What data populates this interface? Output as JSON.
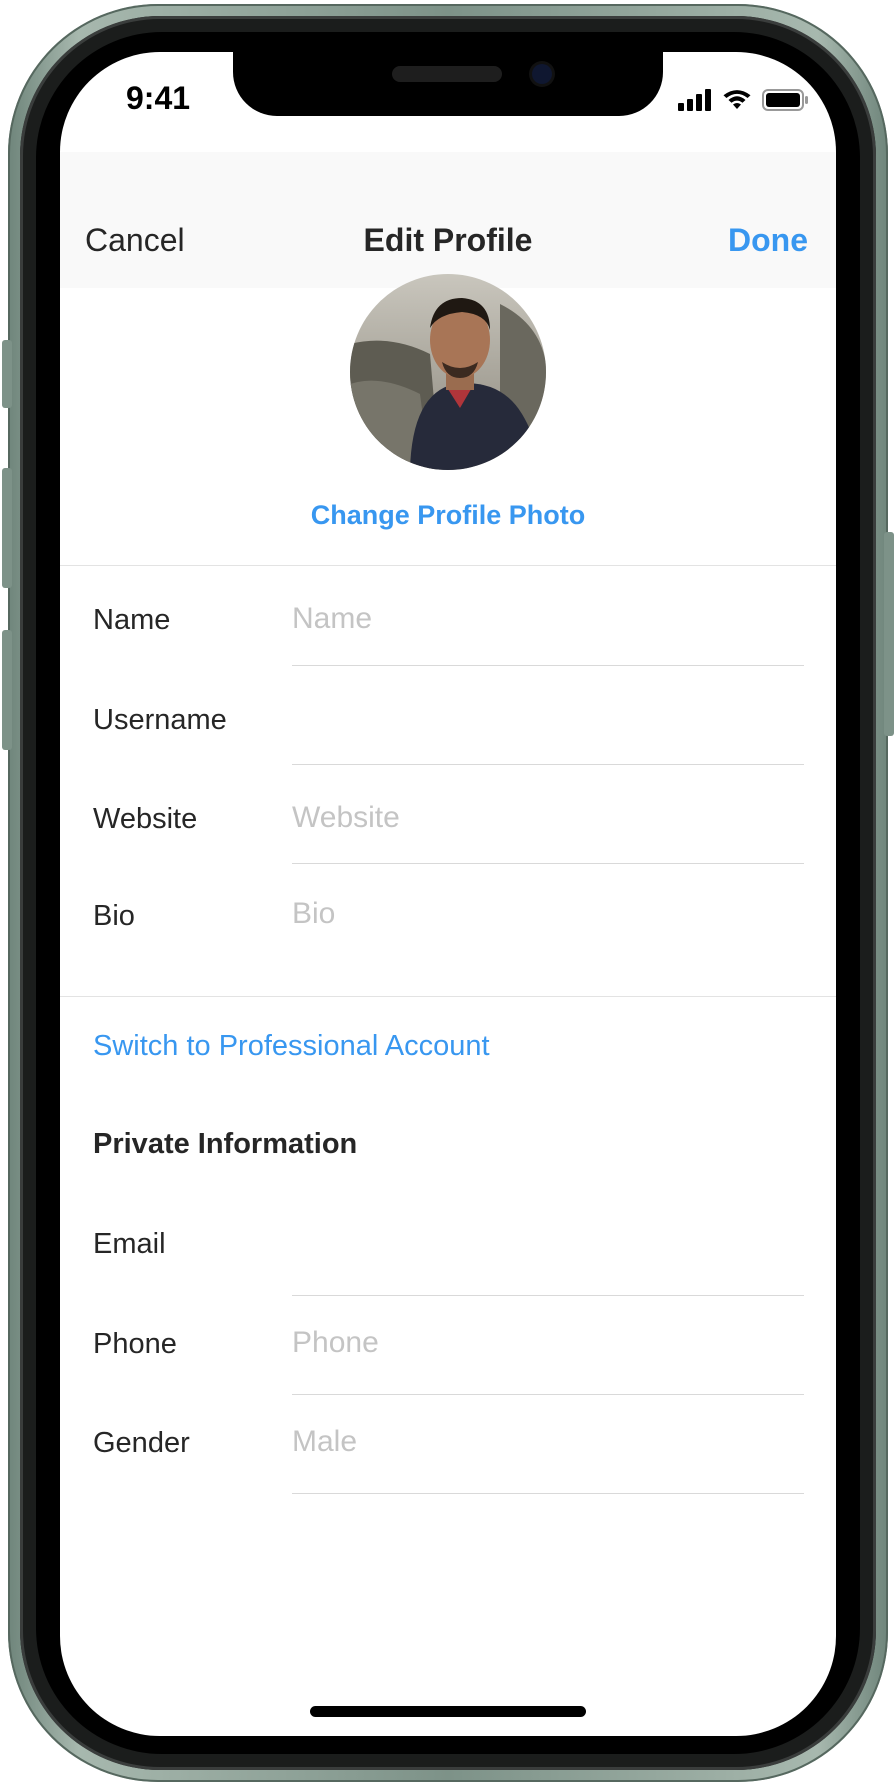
{
  "status_bar": {
    "time": "9:41"
  },
  "nav": {
    "cancel": "Cancel",
    "title": "Edit Profile",
    "done": "Done"
  },
  "profile": {
    "change_photo": "Change Profile Photo"
  },
  "fields": {
    "name": {
      "label": "Name",
      "placeholder": "Name"
    },
    "username": {
      "label": "Username",
      "value": ""
    },
    "website": {
      "label": "Website",
      "placeholder": "Website"
    },
    "bio": {
      "label": "Bio",
      "placeholder": "Bio"
    }
  },
  "switch_professional": "Switch to Professional Account",
  "private": {
    "title": "Private Information",
    "email": {
      "label": "Email",
      "value": ""
    },
    "phone": {
      "label": "Phone",
      "placeholder": "Phone"
    },
    "gender": {
      "label": "Gender",
      "value": "Male"
    }
  },
  "colors": {
    "accent": "#3897f0",
    "text": "#262626",
    "placeholder": "#c4c4c4",
    "frame": "#7d9288"
  }
}
